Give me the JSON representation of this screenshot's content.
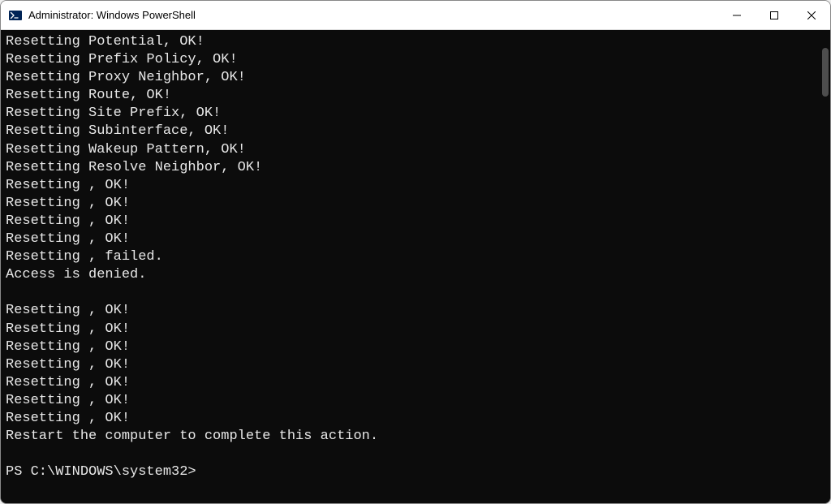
{
  "window": {
    "title": "Administrator: Windows PowerShell"
  },
  "terminal": {
    "lines": [
      "Resetting Potential, OK!",
      "Resetting Prefix Policy, OK!",
      "Resetting Proxy Neighbor, OK!",
      "Resetting Route, OK!",
      "Resetting Site Prefix, OK!",
      "Resetting Subinterface, OK!",
      "Resetting Wakeup Pattern, OK!",
      "Resetting Resolve Neighbor, OK!",
      "Resetting , OK!",
      "Resetting , OK!",
      "Resetting , OK!",
      "Resetting , OK!",
      "Resetting , failed.",
      "Access is denied.",
      "",
      "Resetting , OK!",
      "Resetting , OK!",
      "Resetting , OK!",
      "Resetting , OK!",
      "Resetting , OK!",
      "Resetting , OK!",
      "Resetting , OK!",
      "Restart the computer to complete this action.",
      ""
    ],
    "prompt": "PS C:\\WINDOWS\\system32>"
  }
}
